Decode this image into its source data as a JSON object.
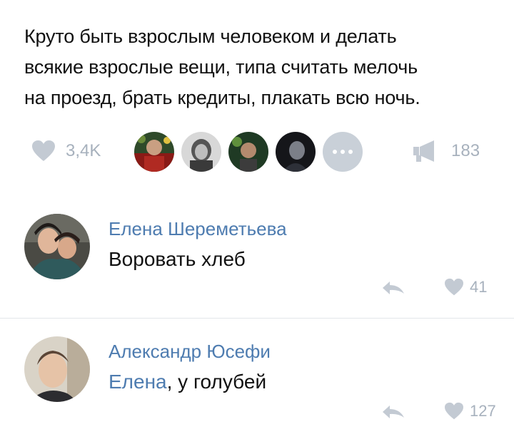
{
  "post": {
    "text_lines": [
      "Круто быть взрослым человеком и делать",
      "всякие взрослые вещи, типа считать мелочь",
      "на проезд, брать кредиты, плакать всю ночь."
    ]
  },
  "stats": {
    "likes": "3,4K",
    "shares": "183",
    "like_icon": "heart-icon",
    "share_icon": "megaphone-icon",
    "more_icon": "ellipsis-icon"
  },
  "comments": [
    {
      "author": "Елена Шереметьева",
      "text": "Воровать хлеб",
      "likes": "41"
    },
    {
      "author": "Александр Юсефи",
      "reply_to": "Елена",
      "text": ", у голубей",
      "likes": "127"
    }
  ],
  "colors": {
    "link": "#4e7cb0",
    "muted": "#a7b1bd",
    "icon": "#c3cad3"
  }
}
